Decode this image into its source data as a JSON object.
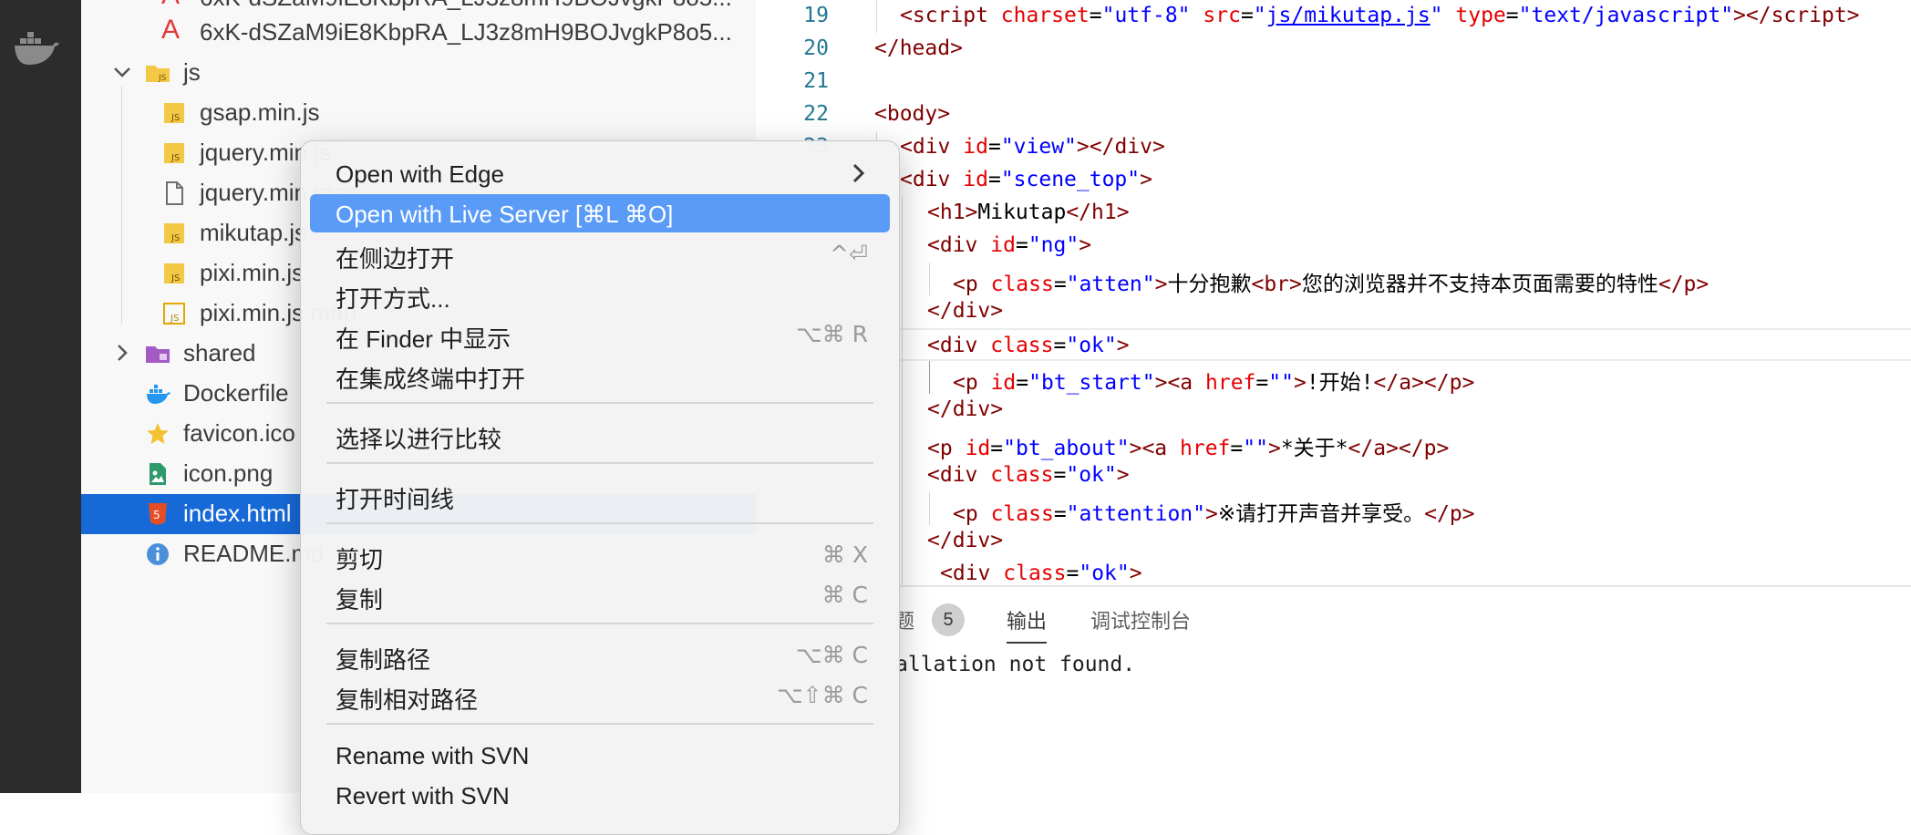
{
  "explorer": {
    "items": [
      {
        "label": "6xK-dSZaM9iE8KbpRA_LJ3z8mH9BOJvgkP8o5..."
      },
      {
        "label": "6xK-dSZaM9iE8KbpRA_LJ3z8mH9BOJvgkP8o5..."
      },
      {
        "label": "js"
      },
      {
        "label": "gsap.min.js"
      },
      {
        "label": "jquery.min.js"
      },
      {
        "label": "jquery.min.map"
      },
      {
        "label": "mikutap.js"
      },
      {
        "label": "pixi.min.js"
      },
      {
        "label": "pixi.min.js.map"
      },
      {
        "label": "shared"
      },
      {
        "label": "Dockerfile"
      },
      {
        "label": "favicon.ico"
      },
      {
        "label": "icon.png"
      },
      {
        "label": "index.html"
      },
      {
        "label": "README.md"
      }
    ]
  },
  "editor": {
    "line_numbers": [
      "19",
      "20",
      "21",
      "22",
      "23"
    ]
  },
  "panel": {
    "tabs": {
      "problems": "题",
      "problems_count": "5",
      "output": "输出",
      "debug_console": "调试控制台"
    },
    "output_text": "allation not found."
  },
  "context_menu": {
    "items": [
      {
        "label": "Open with Edge",
        "shortcut": ""
      },
      {
        "label": "Open with Live Server [⌘L ⌘O]",
        "shortcut": ""
      },
      {
        "label": "在侧边打开",
        "shortcut": "^⏎"
      },
      {
        "label": "打开方式...",
        "shortcut": ""
      },
      {
        "label": "在 Finder 中显示",
        "shortcut": "⌥⌘ R"
      },
      {
        "label": "在集成终端中打开",
        "shortcut": ""
      },
      {
        "label": "选择以进行比较",
        "shortcut": ""
      },
      {
        "label": "打开时间线",
        "shortcut": ""
      },
      {
        "label": "剪切",
        "shortcut": "⌘ X"
      },
      {
        "label": "复制",
        "shortcut": "⌘ C"
      },
      {
        "label": "复制路径",
        "shortcut": "⌥⌘ C"
      },
      {
        "label": "复制相对路径",
        "shortcut": "⌥⇧⌘ C"
      },
      {
        "label": "Rename with SVN",
        "shortcut": ""
      },
      {
        "label": "Revert with SVN",
        "shortcut": ""
      }
    ]
  },
  "colors": {
    "selection": "#1769d8",
    "menu_highlight": "#5b9bf8",
    "activity_bar": "#2c2c2c"
  }
}
